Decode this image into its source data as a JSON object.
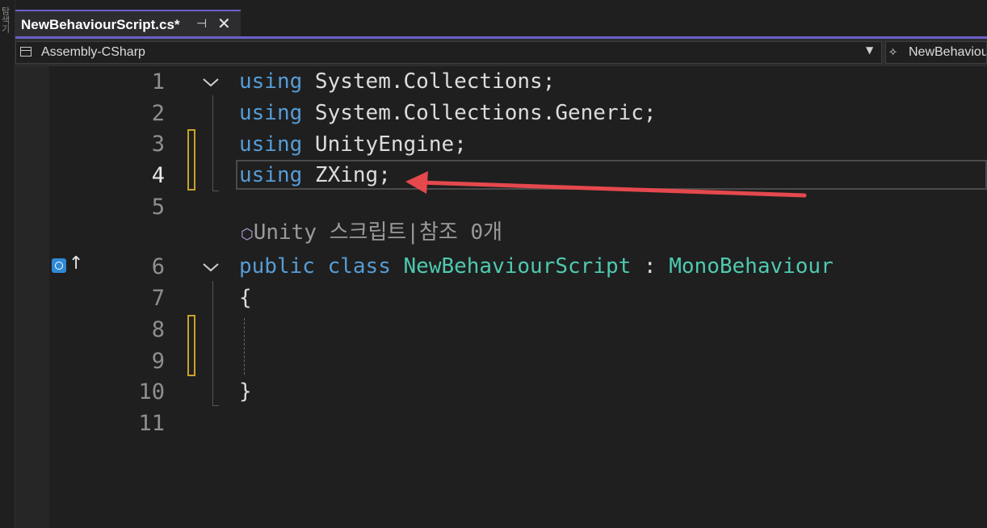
{
  "tab": {
    "title": "NewBehaviourScript.cs*",
    "pin_glyph": "⊣",
    "close_glyph": "✕"
  },
  "left_panel": {
    "vertical_text": "탐색기"
  },
  "navbar": {
    "project": "Assembly-CSharp",
    "class_scope": "NewBehaviourScript"
  },
  "editor": {
    "line_numbers": [
      "1",
      "2",
      "3",
      "4",
      "5",
      "6",
      "7",
      "8",
      "9",
      "10",
      "11"
    ],
    "active_line": 4,
    "lines": [
      {
        "kw": "using",
        "rest": " System.Collections;"
      },
      {
        "kw": "using",
        "rest": " System.Collections.Generic;"
      },
      {
        "kw": "using",
        "rest": " UnityEngine;"
      },
      {
        "kw": "using",
        "rest": " ZXing;"
      },
      {
        "kw1": "public",
        "kw2": "class",
        "type1": "NewBehaviourScript",
        "sep": " : ",
        "type2": "MonoBehaviour"
      },
      {
        "text": "{"
      },
      {
        "text": "}"
      }
    ],
    "code_lens": {
      "icon": "⬡",
      "text": "Unity 스크립트|참조 0개"
    }
  },
  "colors": {
    "keyword": "#569cd6",
    "type": "#4ec9b0",
    "accent": "#6b60c9",
    "change_marker": "#c9a227",
    "arrow": "#e5484d"
  },
  "icons": [
    "pin-icon",
    "close-icon",
    "project-icon",
    "dropdown-arrow-icon",
    "class-scope-icon",
    "breakpoint-glyph-icon",
    "fold-chevron-icon",
    "unity-icon"
  ]
}
